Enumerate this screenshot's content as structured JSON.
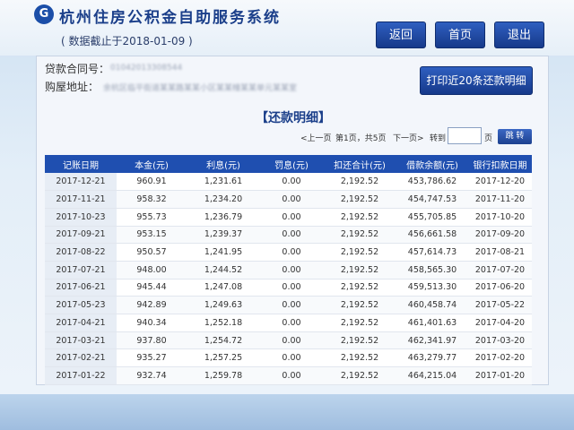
{
  "header": {
    "logo_glyph": "G",
    "title": "杭州住房公积金自助服务系统",
    "date_note": "( 数据截止于2018-01-09 )",
    "nav": {
      "back_label": "返回",
      "home_label": "首页",
      "exit_label": "退出"
    }
  },
  "info": {
    "contract_label": "贷款合同号：",
    "contract_value": "01042013308544",
    "address_label": "购屋地址：",
    "address_value": "余杭区临平街道某某路某某小区某某幢某某单元某某室",
    "print_label": "打印近20条还款明细"
  },
  "section_title": "【还款明细】",
  "pager": {
    "prev": "<上一页",
    "page_info": "第1页，共5页",
    "next": "下一页>",
    "goto_prefix": "转到",
    "goto_suffix": "页",
    "jump_label": "跳 转",
    "input_value": ""
  },
  "table": {
    "columns": [
      "记账日期",
      "本金(元)",
      "利息(元)",
      "罚息(元)",
      "扣还合计(元)",
      "借款余额(元)",
      "银行扣款日期"
    ],
    "rows": [
      [
        "2017-12-21",
        "960.91",
        "1,231.61",
        "0.00",
        "2,192.52",
        "453,786.62",
        "2017-12-20"
      ],
      [
        "2017-11-21",
        "958.32",
        "1,234.20",
        "0.00",
        "2,192.52",
        "454,747.53",
        "2017-11-20"
      ],
      [
        "2017-10-23",
        "955.73",
        "1,236.79",
        "0.00",
        "2,192.52",
        "455,705.85",
        "2017-10-20"
      ],
      [
        "2017-09-21",
        "953.15",
        "1,239.37",
        "0.00",
        "2,192.52",
        "456,661.58",
        "2017-09-20"
      ],
      [
        "2017-08-22",
        "950.57",
        "1,241.95",
        "0.00",
        "2,192.52",
        "457,614.73",
        "2017-08-21"
      ],
      [
        "2017-07-21",
        "948.00",
        "1,244.52",
        "0.00",
        "2,192.52",
        "458,565.30",
        "2017-07-20"
      ],
      [
        "2017-06-21",
        "945.44",
        "1,247.08",
        "0.00",
        "2,192.52",
        "459,513.30",
        "2017-06-20"
      ],
      [
        "2017-05-23",
        "942.89",
        "1,249.63",
        "0.00",
        "2,192.52",
        "460,458.74",
        "2017-05-22"
      ],
      [
        "2017-04-21",
        "940.34",
        "1,252.18",
        "0.00",
        "2,192.52",
        "461,401.63",
        "2017-04-20"
      ],
      [
        "2017-03-21",
        "937.80",
        "1,254.72",
        "0.00",
        "2,192.52",
        "462,341.97",
        "2017-03-20"
      ],
      [
        "2017-02-21",
        "935.27",
        "1,257.25",
        "0.00",
        "2,192.52",
        "463,279.77",
        "2017-02-20"
      ],
      [
        "2017-01-22",
        "932.74",
        "1,259.78",
        "0.00",
        "2,192.52",
        "464,215.04",
        "2017-01-20"
      ]
    ]
  },
  "colors": {
    "primary": "#1f4fb0",
    "button": "#16398a",
    "title_text": "#1b3f8a"
  }
}
